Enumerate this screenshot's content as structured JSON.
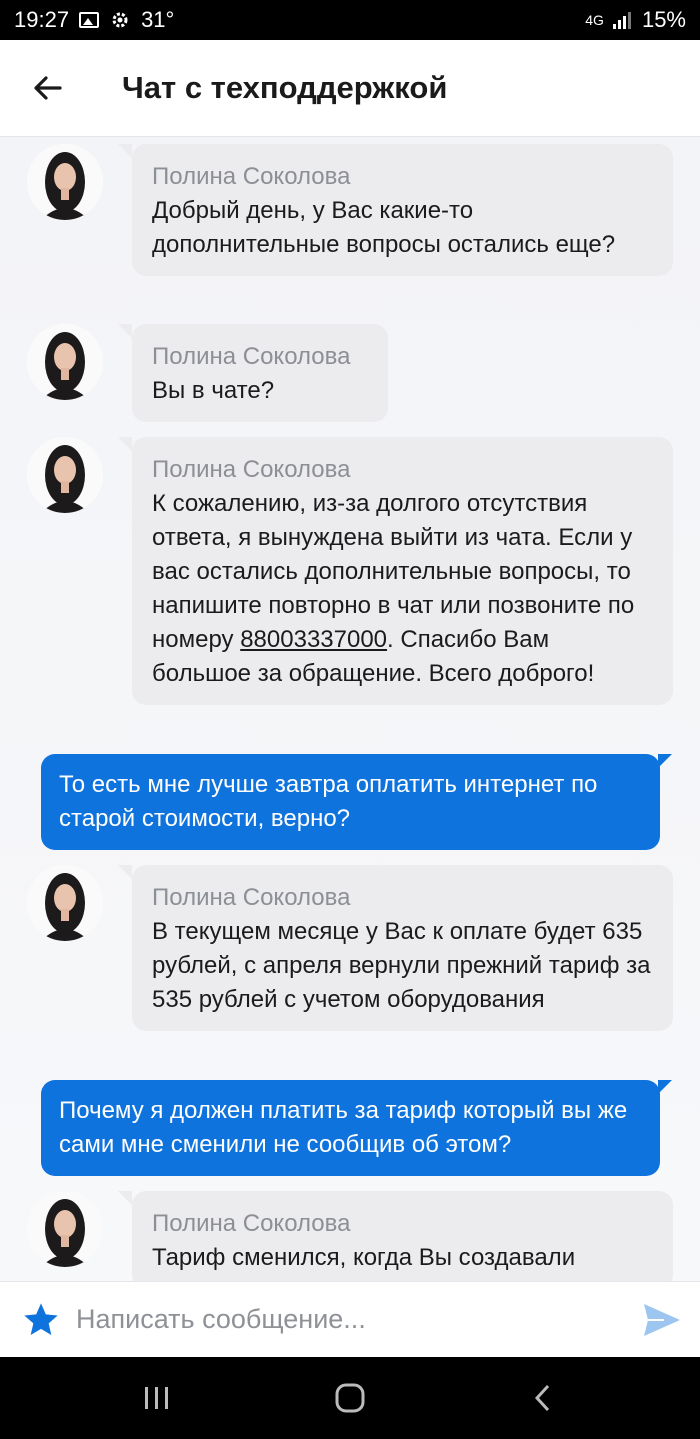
{
  "status_bar": {
    "time": "19:27",
    "temperature": "31°",
    "network": "4G",
    "battery": "15%"
  },
  "header": {
    "title": "Чат с техподдержкой"
  },
  "messages": [
    {
      "direction": "in",
      "sender": "Полина Соколова",
      "text": "Добрый день, у Вас какие-то дополнительные вопросы остались еще?"
    },
    {
      "direction": "in",
      "sender": "Полина Соколова",
      "text": "Вы в чате?"
    },
    {
      "direction": "in",
      "sender": "Полина Соколова",
      "text_before": "К сожалению, из-за долгого отсутствия ответа, я вынуждена выйти из чата. Если у вас остались дополнительные вопросы, то напишите повторно в чат или позвоните по номеру ",
      "phone": "88003337000",
      "text_after": ". Спасибо Вам большое за обращение. Всего доброго!"
    },
    {
      "direction": "out",
      "text": "То есть мне лучше завтра оплатить интернет по старой стоимости, верно?"
    },
    {
      "direction": "in",
      "sender": "Полина Соколова",
      "text": "В текущем месяце у Вас к оплате будет 635 рублей, с апреля вернули прежний тариф за 535 рублей с учетом оборудования"
    },
    {
      "direction": "out",
      "text": "Почему я должен платить за тариф который вы же сами мне сменили не сообщив об этом?"
    },
    {
      "direction": "in",
      "sender": "Полина Соколова",
      "text": "Тариф сменился, когда Вы создавали"
    }
  ],
  "composer": {
    "placeholder": "Написать сообщение..."
  },
  "colors": {
    "accent": "#0f73dd",
    "incoming_bubble": "#ececef",
    "send_icon": "#9cc6f0"
  },
  "icons": {
    "back": "arrow-left-icon",
    "favorite": "star-icon",
    "send": "send-icon",
    "recents": "recents-icon",
    "home": "home-icon",
    "nav_back": "chevron-left-icon"
  }
}
